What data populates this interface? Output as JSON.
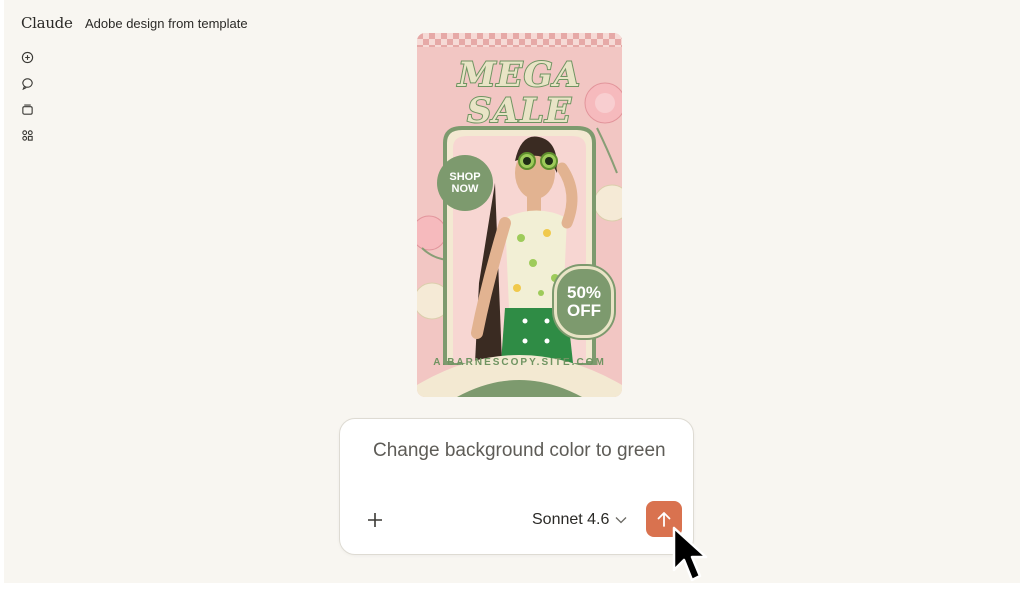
{
  "app": {
    "logo": "Claude",
    "title": "Adobe design from template"
  },
  "sidebar": {
    "items": [
      {
        "icon": "new-chat-icon"
      },
      {
        "icon": "chats-icon"
      },
      {
        "icon": "projects-icon"
      },
      {
        "icon": "artifacts-icon"
      }
    ]
  },
  "poster": {
    "headline_top": "MEGA",
    "headline_bottom": "SALE",
    "shop_badge": "SHOP NOW",
    "discount_badge": "50% OFF",
    "url": "A.BARNESCOPY.SITE.COM",
    "colors": {
      "background": "#f2c6c3",
      "accent": "#7d9a6e",
      "cream": "#e9e4c6"
    }
  },
  "prompt": {
    "text": "Change background color to green",
    "model": "Sonnet 4.6",
    "send_color": "#d9724f"
  }
}
